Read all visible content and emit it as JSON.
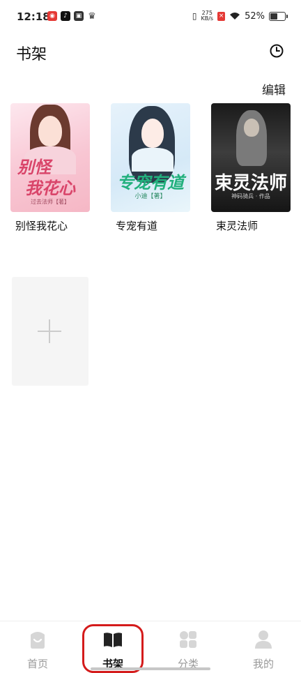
{
  "status_bar": {
    "time": "12:18",
    "net_speed_top": "275",
    "net_speed_bottom": "KB/s",
    "battery": "52%"
  },
  "header": {
    "title": "书架",
    "history_icon": "clock-icon",
    "edit_label": "编辑"
  },
  "books": [
    {
      "title": "别怪我花心",
      "cover_text_line1": "别怪",
      "cover_text_line2": "我花心",
      "cover_author": "过去法师【著】"
    },
    {
      "title": "专宠有道",
      "cover_text": "专宠有道",
      "cover_author": "小迪【著】"
    },
    {
      "title": "束灵法师",
      "cover_text": "束灵法师",
      "cover_author": "神码骑兵 · 作品"
    }
  ],
  "add_slot": {
    "icon": "plus-icon"
  },
  "bottom_nav": [
    {
      "label": "首页",
      "icon": "home-smile-icon",
      "active": false
    },
    {
      "label": "书架",
      "icon": "open-book-icon",
      "active": true
    },
    {
      "label": "分类",
      "icon": "category-grid-icon",
      "active": false
    },
    {
      "label": "我的",
      "icon": "user-icon",
      "active": false
    }
  ],
  "colors": {
    "highlight_ring": "#d41b1b",
    "inactive_nav": "#999999",
    "active_nav": "#111111"
  }
}
